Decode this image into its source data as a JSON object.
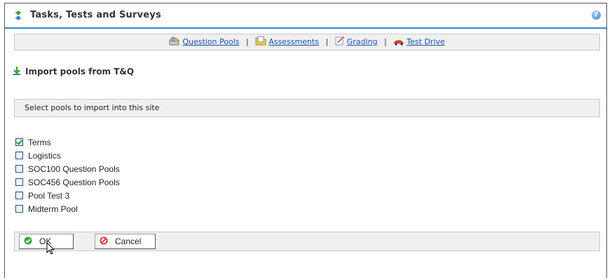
{
  "header": {
    "title": "Tasks, Tests and Surveys",
    "help_icon": "help-icon"
  },
  "nav": {
    "question_pools": "Question Pools",
    "assessments": "Assessments",
    "grading": "Grading",
    "test_drive": "Test Drive",
    "separator": "|"
  },
  "section": {
    "title": "Import pools from T&Q"
  },
  "instructions": "Select pools to import into this site",
  "pools": [
    {
      "label": "Terms",
      "checked": true
    },
    {
      "label": "Logistics",
      "checked": false
    },
    {
      "label": "SOC100 Question Pools",
      "checked": false
    },
    {
      "label": "SOC456 Question Pools",
      "checked": false
    },
    {
      "label": "Pool Test 3",
      "checked": false
    },
    {
      "label": "Midterm Pool",
      "checked": false
    }
  ],
  "actions": {
    "ok": "OK",
    "cancel": "Cancel"
  },
  "colors": {
    "accent": "#2f8bd0",
    "link": "#1a52a8",
    "bar_bg": "#f0f0f0"
  }
}
